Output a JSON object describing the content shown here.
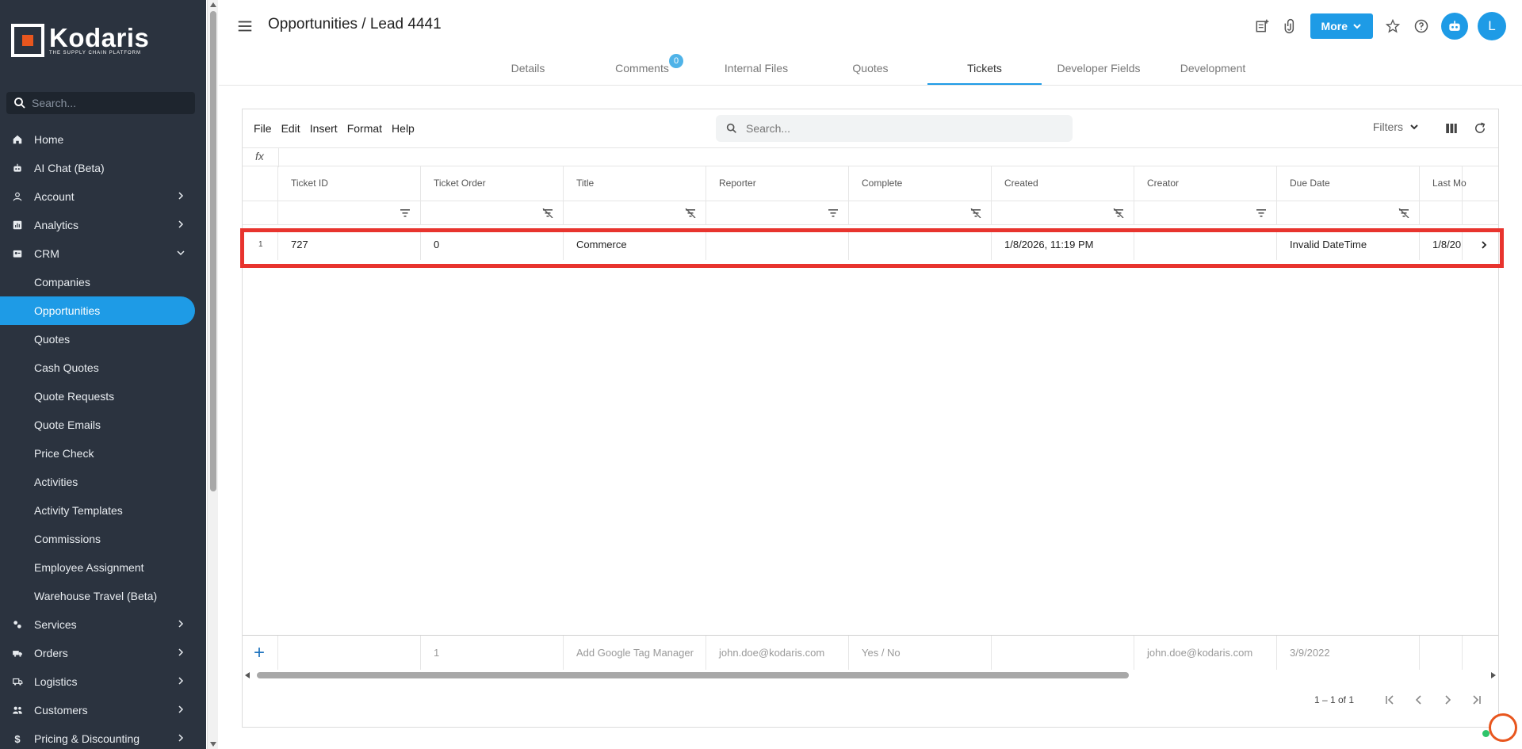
{
  "brand": {
    "name": "Kodaris",
    "tagline": "THE SUPPLY CHAIN PLATFORM",
    "accent": "#1e9be6",
    "logo_color": "#e8561e"
  },
  "sidebar": {
    "search_placeholder": "Search...",
    "items": [
      {
        "label": "Home",
        "icon": "home-icon"
      },
      {
        "label": "AI Chat (Beta)",
        "icon": "robot-icon"
      },
      {
        "label": "Account",
        "icon": "user-icon",
        "chevron": "right"
      },
      {
        "label": "Analytics",
        "icon": "chart-icon",
        "chevron": "right"
      },
      {
        "label": "CRM",
        "icon": "crm-icon",
        "chevron": "down"
      },
      {
        "label": "Companies",
        "sub": true
      },
      {
        "label": "Opportunities",
        "sub": true,
        "active": true
      },
      {
        "label": "Quotes",
        "sub": true
      },
      {
        "label": "Cash Quotes",
        "sub": true
      },
      {
        "label": "Quote Requests",
        "sub": true
      },
      {
        "label": "Quote Emails",
        "sub": true
      },
      {
        "label": "Price Check",
        "sub": true
      },
      {
        "label": "Activities",
        "sub": true
      },
      {
        "label": "Activity Templates",
        "sub": true
      },
      {
        "label": "Commissions",
        "sub": true
      },
      {
        "label": "Employee Assignment",
        "sub": true
      },
      {
        "label": "Warehouse Travel (Beta)",
        "sub": true
      },
      {
        "label": "Services",
        "icon": "services-icon",
        "chevron": "right"
      },
      {
        "label": "Orders",
        "icon": "truck-icon",
        "chevron": "right"
      },
      {
        "label": "Logistics",
        "icon": "logistics-icon",
        "chevron": "right"
      },
      {
        "label": "Customers",
        "icon": "customers-icon",
        "chevron": "right"
      },
      {
        "label": "Pricing & Discounting",
        "icon": "dollar-icon",
        "chevron": "right"
      }
    ]
  },
  "header": {
    "title": "Opportunities / Lead 4441",
    "more_label": "More",
    "avatar_initial": "L"
  },
  "tabs": [
    {
      "label": "Details"
    },
    {
      "label": "Comments",
      "badge": "0"
    },
    {
      "label": "Internal Files"
    },
    {
      "label": "Quotes"
    },
    {
      "label": "Tickets",
      "active": true
    },
    {
      "label": "Developer Fields"
    },
    {
      "label": "Development"
    }
  ],
  "toolbar": {
    "menus": [
      "File",
      "Edit",
      "Insert",
      "Format",
      "Help"
    ],
    "search_placeholder": "Search...",
    "filters_label": "Filters"
  },
  "formula_bar": {
    "label": "fx"
  },
  "grid": {
    "columns": [
      "Ticket ID",
      "Ticket Order",
      "Title",
      "Reporter",
      "Complete",
      "Created",
      "Creator",
      "Due Date",
      "Last Mo"
    ],
    "rows": [
      {
        "num": "1",
        "cells": [
          "727",
          "0",
          "Commerce",
          "",
          "",
          "1/8/2026, 11:19 PM",
          "",
          "Invalid DateTime",
          "1/8/20"
        ]
      }
    ],
    "new_row_placeholders": [
      "",
      "1",
      "Add Google Tag Manager",
      "john.doe@kodaris.com",
      "Yes / No",
      "",
      "john.doe@kodaris.com",
      "3/9/2022",
      ""
    ],
    "highlight_color": "#e8342e"
  },
  "pager": {
    "count_text": "1 – 1 of 1"
  }
}
